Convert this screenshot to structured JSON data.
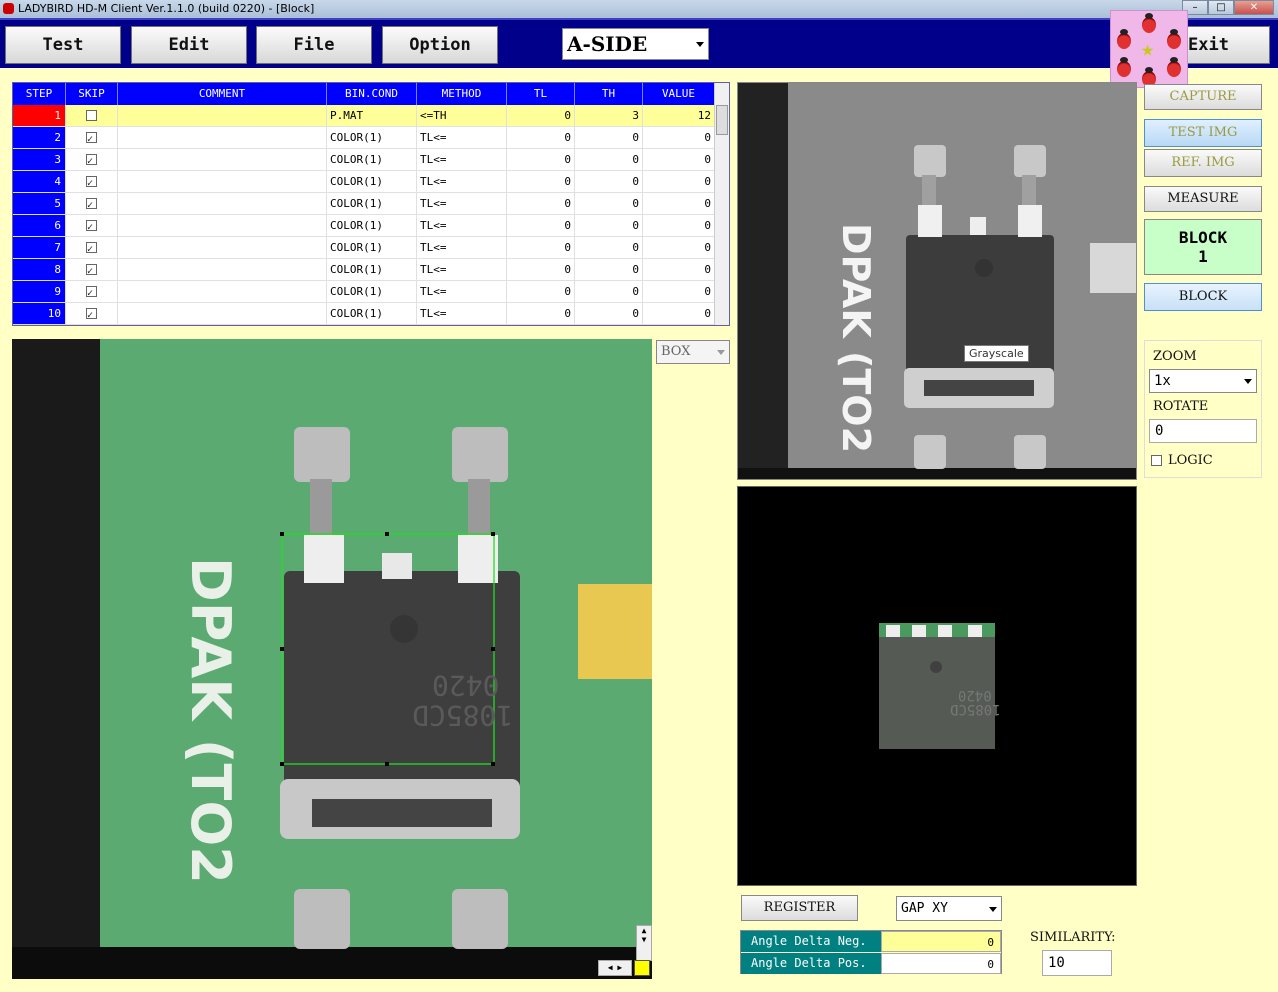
{
  "window": {
    "title": "LADYBIRD HD-M Client Ver.1.1.0  (build 0220) - [Block]"
  },
  "menu": {
    "test": "Test",
    "edit": "Edit",
    "file": "File",
    "option": "Option",
    "exit": "Exit",
    "side_select": "A-SIDE"
  },
  "grid": {
    "headers": [
      "STEP",
      "SKIP",
      "COMMENT",
      "BIN.COND",
      "METHOD",
      "TL",
      "TH",
      "VALUE"
    ],
    "rows": [
      {
        "step": "1",
        "skip": false,
        "comment": "",
        "bin": "P.MAT",
        "method": "<=TH",
        "tl": "0",
        "th": "3",
        "value": "12"
      },
      {
        "step": "2",
        "skip": true,
        "comment": "",
        "bin": "COLOR(1)",
        "method": "TL<=",
        "tl": "0",
        "th": "0",
        "value": "0"
      },
      {
        "step": "3",
        "skip": true,
        "comment": "",
        "bin": "COLOR(1)",
        "method": "TL<=",
        "tl": "0",
        "th": "0",
        "value": "0"
      },
      {
        "step": "4",
        "skip": true,
        "comment": "",
        "bin": "COLOR(1)",
        "method": "TL<=",
        "tl": "0",
        "th": "0",
        "value": "0"
      },
      {
        "step": "5",
        "skip": true,
        "comment": "",
        "bin": "COLOR(1)",
        "method": "TL<=",
        "tl": "0",
        "th": "0",
        "value": "0"
      },
      {
        "step": "6",
        "skip": true,
        "comment": "",
        "bin": "COLOR(1)",
        "method": "TL<=",
        "tl": "0",
        "th": "0",
        "value": "0"
      },
      {
        "step": "7",
        "skip": true,
        "comment": "",
        "bin": "COLOR(1)",
        "method": "TL<=",
        "tl": "0",
        "th": "0",
        "value": "0"
      },
      {
        "step": "8",
        "skip": true,
        "comment": "",
        "bin": "COLOR(1)",
        "method": "TL<=",
        "tl": "0",
        "th": "0",
        "value": "0"
      },
      {
        "step": "9",
        "skip": true,
        "comment": "",
        "bin": "COLOR(1)",
        "method": "TL<=",
        "tl": "0",
        "th": "0",
        "value": "0"
      },
      {
        "step": "10",
        "skip": true,
        "comment": "",
        "bin": "COLOR(1)",
        "method": "TL<=",
        "tl": "0",
        "th": "0",
        "value": "0"
      }
    ]
  },
  "box_select": "BOX",
  "right": {
    "capture": "CAPTURE",
    "test_img": "TEST  IMG",
    "ref_img": "REF.  IMG",
    "measure": "MEASURE",
    "block_label": "BLOCK",
    "block_num": "1",
    "block_btn": "BLOCK",
    "zoom_label": "ZOOM",
    "zoom_value": "1x",
    "rotate_label": "ROTATE",
    "rotate_value": "0",
    "logic_label": "LOGIC"
  },
  "tooltip": "Grayscale",
  "board": {
    "silkscreen": "DPAK (TO2",
    "chip_marking_1": "0420",
    "chip_marking_2": "1085CD"
  },
  "bottom": {
    "register": "REGISTER",
    "gap_select": "GAP XY",
    "angle_neg_label": "Angle Delta Neg.",
    "angle_neg_value": "0",
    "angle_pos_label": "Angle Delta Pos.",
    "angle_pos_value": "0",
    "similarity_label": "SIMILARITY:",
    "similarity_value": "10"
  },
  "colors": {
    "menubar": "#00008b",
    "background": "#ffffc6",
    "grid_header": "#0000ff",
    "selected_step": "#ff0000",
    "block_panel": "#c8ffc8",
    "pcb": "#58a870"
  }
}
